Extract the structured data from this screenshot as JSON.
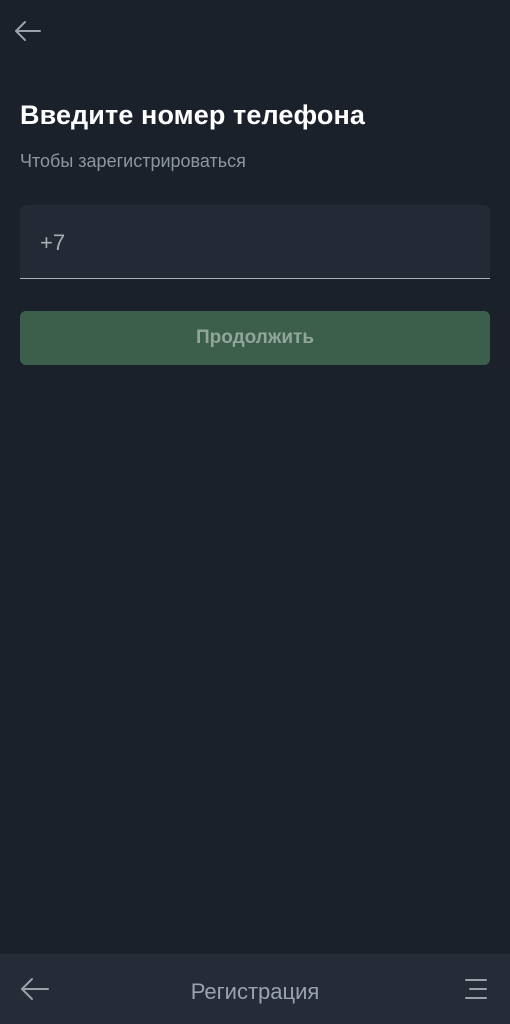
{
  "header": {
    "back_icon": "back-arrow-icon"
  },
  "main": {
    "title": "Введите номер телефона",
    "subtitle": "Чтобы зарегистрироваться",
    "phone_field": {
      "value": "+7"
    },
    "continue_label": "Продолжить"
  },
  "bottom_bar": {
    "back_icon": "back-arrow-icon",
    "title": "Регистрация",
    "menu_icon": "menu-icon"
  },
  "colors": {
    "background": "#1b212b",
    "field_background": "#232a35",
    "button_background": "#3c5f4b",
    "bottom_bar_background": "#252c37",
    "title_text": "#ffffff",
    "secondary_text": "#8e969f"
  }
}
